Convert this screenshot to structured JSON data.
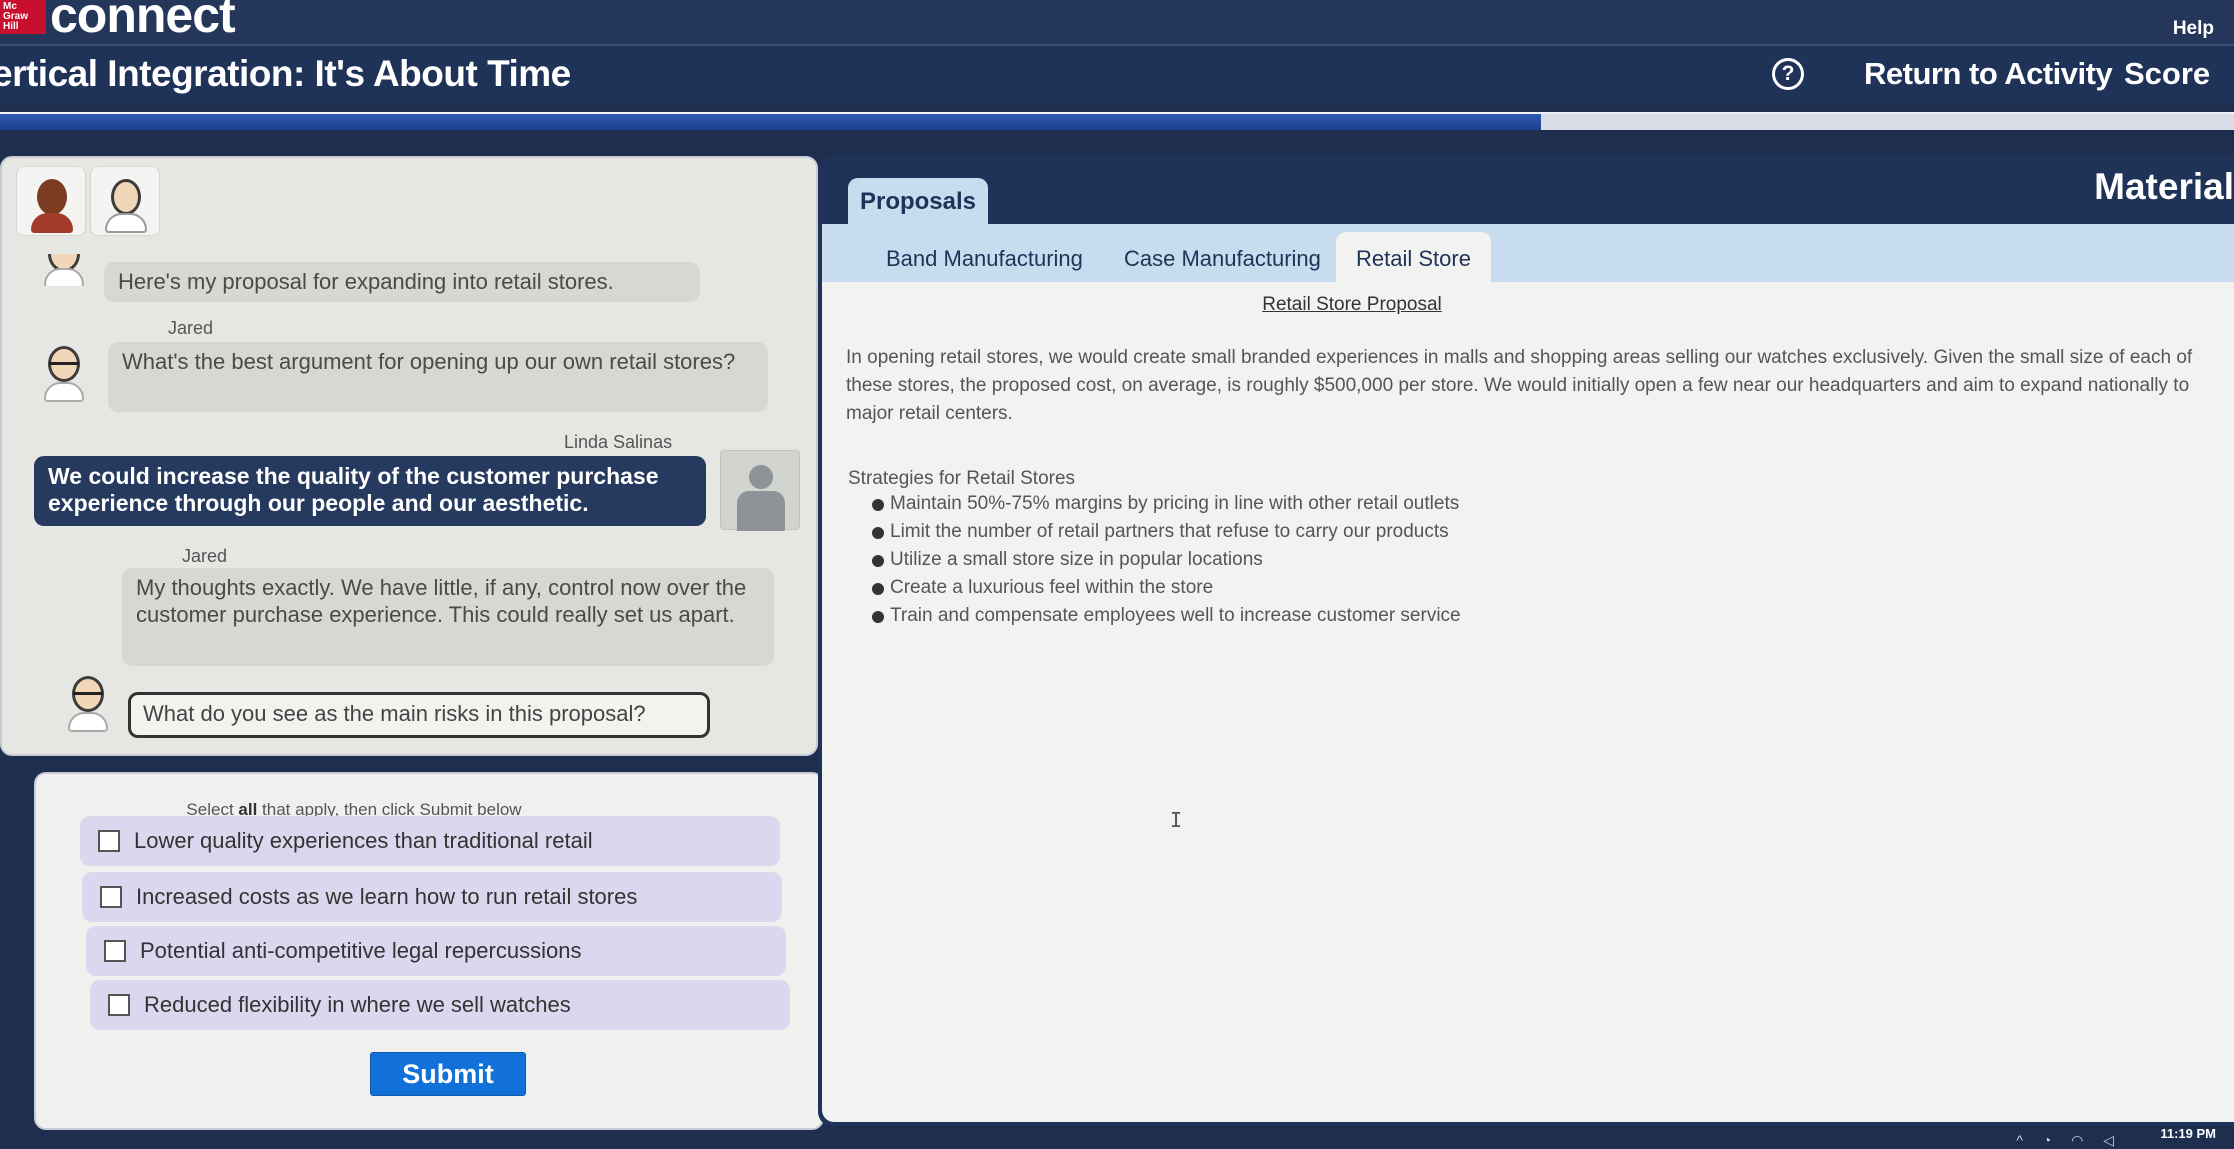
{
  "header": {
    "logo_box": "Mc Graw Hill",
    "logo_text": "connect",
    "help_label": "Help"
  },
  "titlebar": {
    "title": "ertical Integration: It's About Time",
    "help_icon_glyph": "?",
    "return_label": "Return to Activity",
    "score_label": "Score",
    "progress_percent": 69
  },
  "chat": {
    "messages": [
      {
        "speaker": "",
        "text": "Here's my proposal for expanding into retail stores."
      },
      {
        "speaker": "Jared",
        "text": "What's the best argument for opening up our own retail stores?"
      },
      {
        "speaker": "Linda Salinas",
        "text": "We could increase the quality of the customer purchase experience through our people and our aesthetic."
      },
      {
        "speaker": "Jared",
        "text": "My thoughts exactly. We have little, if any, control now over the customer purchase experience. This could really set us apart."
      },
      {
        "speaker": "",
        "text": "What do you see as the main risks in this proposal?"
      }
    ]
  },
  "answers": {
    "instructions_pre": "Select ",
    "instructions_bold": "all",
    "instructions_post": " that apply, then click Submit below",
    "options": [
      {
        "label": "Lower quality experiences than traditional retail",
        "checked": false
      },
      {
        "label": "Increased costs as we learn how to run retail stores",
        "checked": false
      },
      {
        "label": "Potential anti-competitive legal repercussions",
        "checked": false
      },
      {
        "label": "Reduced flexibility in where we sell watches",
        "checked": false
      }
    ],
    "submit_label": "Submit"
  },
  "materials": {
    "title": "Material",
    "main_tab": "Proposals",
    "subtabs": [
      "Band Manufacturing",
      "Case Manufacturing",
      "Retail Store"
    ],
    "active_subtab": "Retail Store",
    "doc_title": "Retail Store Proposal",
    "paragraph": "In opening retail stores, we would create small branded experiences in malls and shopping areas selling our watches exclusively. Given the small size of each of these stores, the proposed cost, on average, is roughly $500,000 per store. We would initially open a few near our headquarters and aim to expand nationally to major retail centers.",
    "strategies_heading": "Strategies for Retail Stores",
    "strategies": [
      "Maintain 50%-75% margins by pricing in line with other retail outlets",
      "Limit the number of retail partners that refuse to carry our products",
      "Utilize a small store size in popular locations",
      "Create a luxurious feel within the store",
      "Train and compensate employees well to increase customer service"
    ]
  },
  "taskbar": {
    "clock": "11:19 PM"
  },
  "colors": {
    "navy": "#1f3258",
    "submit_blue": "#1271d8",
    "option_lavender": "#dad8ee",
    "tab_lightblue": "#c8dcef",
    "logo_red": "#c8102e"
  }
}
